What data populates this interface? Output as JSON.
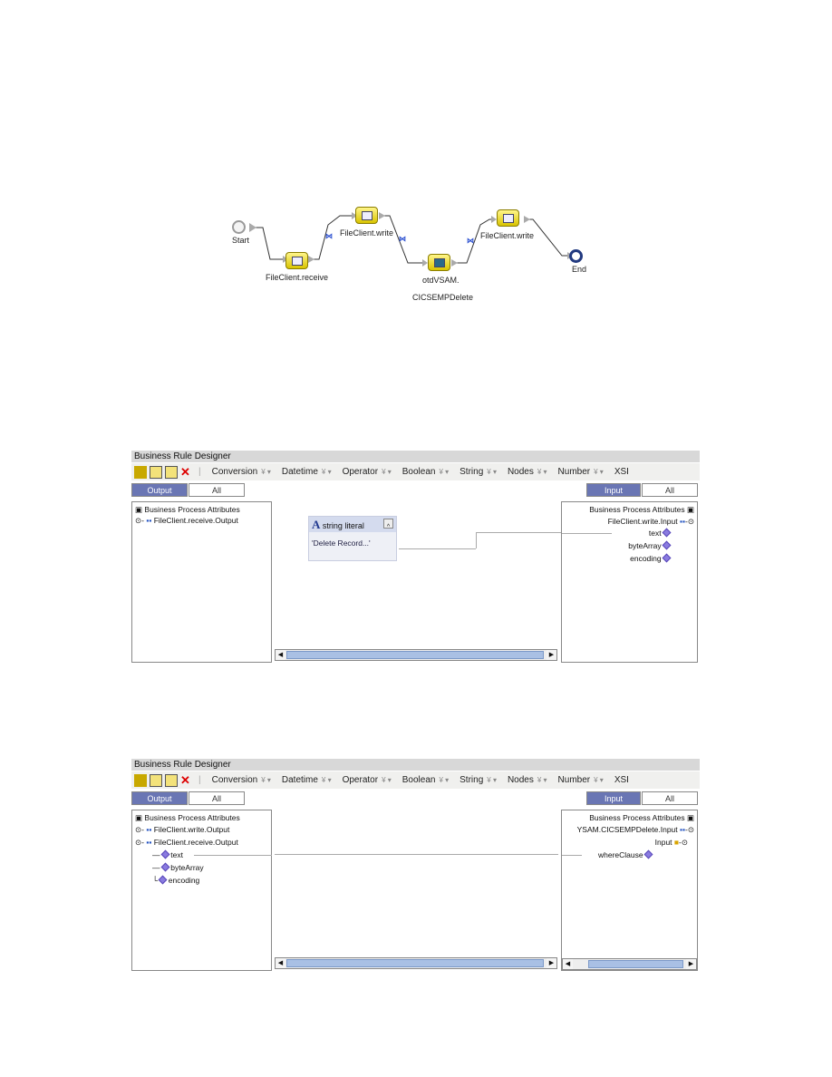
{
  "process_diagram": {
    "nodes": [
      {
        "id": "start",
        "label": "Start"
      },
      {
        "id": "receive",
        "label": "FileClient.receive"
      },
      {
        "id": "write1",
        "label": "FileClient.write"
      },
      {
        "id": "vsam",
        "label": "otdVSAM.",
        "label2": "CICSEMPDelete"
      },
      {
        "id": "write2",
        "label": "FileClient.write"
      },
      {
        "id": "end",
        "label": "End"
      }
    ]
  },
  "designer1": {
    "title": "Business Rule Designer",
    "toolbar_menus": [
      "Conversion",
      "Datetime",
      "Operator",
      "Boolean",
      "String",
      "Nodes",
      "Number",
      "XSI"
    ],
    "output_tab": "Output",
    "output_all": "All",
    "input_tab": "Input",
    "input_all": "All",
    "left_tree": [
      "Business Process Attributes",
      "FileClient.receive.Output"
    ],
    "literal": {
      "title": "string literal",
      "value": "'Delete Record...'"
    },
    "right_tree": [
      "Business Process Attributes",
      "FileClient.write.Input",
      "text",
      "byteArray",
      "encoding"
    ]
  },
  "designer2": {
    "title": "Business Rule Designer",
    "toolbar_menus": [
      "Conversion",
      "Datetime",
      "Operator",
      "Boolean",
      "String",
      "Nodes",
      "Number",
      "XSI"
    ],
    "output_tab": "Output",
    "output_all": "All",
    "input_tab": "Input",
    "input_all": "All",
    "left_tree": [
      "Business Process Attributes",
      "FileClient.write.Output",
      "FileClient.receive.Output",
      "text",
      "byteArray",
      "encoding"
    ],
    "right_tree": [
      "Business Process Attributes",
      "YSAM.CICSEMPDelete.Input",
      "Input",
      "whereClause"
    ]
  },
  "colors": {
    "tab_active": "#6a76b4",
    "attr_diamond": "#8a7be0",
    "scroll_thumb": "#a9c0e4"
  }
}
